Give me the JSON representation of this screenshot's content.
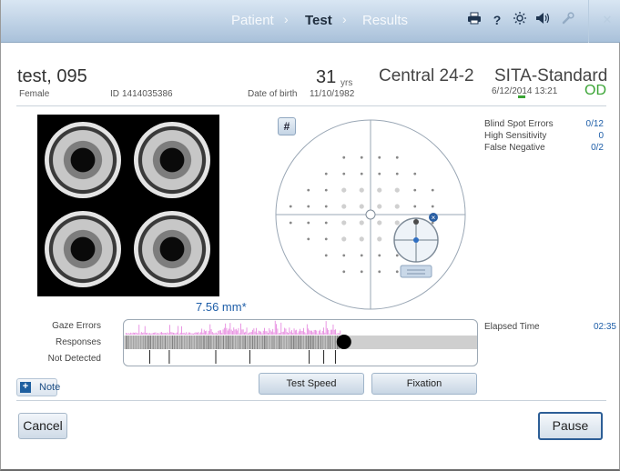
{
  "nav": {
    "crumbs": [
      "Patient",
      "Test",
      "Results"
    ],
    "active": "Test",
    "separator": "›",
    "icons": [
      "printer-icon",
      "help-icon",
      "brightness-icon",
      "volume-icon",
      "wrench-icon",
      "close-icon"
    ],
    "help_glyph": "?",
    "close_glyph": "✕"
  },
  "patient": {
    "name": "test, 095",
    "gender": "Female",
    "id_label": "ID",
    "id": "1414035386",
    "age": "31",
    "age_unit": "yrs",
    "dob_label": "Date of birth",
    "dob": "11/10/1982"
  },
  "test": {
    "program": "Central 24-2",
    "strategy": "SITA-Standard",
    "datetime": "6/12/2014 13:21",
    "eye": "OD"
  },
  "pupil": {
    "diameter": "7.56 mm*"
  },
  "grid_button": "#",
  "reliability": [
    {
      "label": "Blind Spot Errors",
      "value": "0/12"
    },
    {
      "label": "High Sensitivity",
      "value": "0"
    },
    {
      "label": "False Negative",
      "value": "0/2"
    }
  ],
  "monitor": {
    "gaze_label": "Gaze Errors",
    "responses_label": "Responses",
    "not_detected_label": "Not Detected",
    "progress": 0.62
  },
  "elapsed": {
    "label": "Elapsed Time",
    "value": "02:35"
  },
  "buttons": {
    "note": "Note",
    "test_speed": "Test Speed",
    "fixation": "Fixation",
    "cancel": "Cancel",
    "pause": "Pause"
  },
  "colors": {
    "accent": "#1e5ea8",
    "eye_ok": "#3aa435",
    "gaze": "#e78be0"
  }
}
